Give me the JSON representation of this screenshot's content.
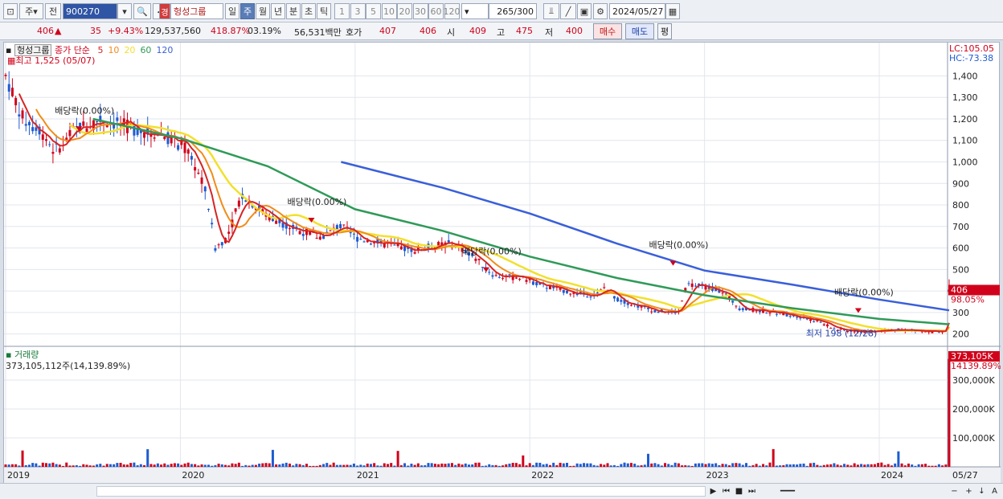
{
  "toolbar": {
    "period_short": "주",
    "prev_label": "전",
    "stock_code": "900270",
    "badge": "경",
    "stock_name": "헝성그룹",
    "periods": [
      "일",
      "주",
      "월",
      "년",
      "분",
      "초",
      "틱"
    ],
    "active_period": "주",
    "numbers": [
      "1",
      "3",
      "5",
      "10",
      "20",
      "30",
      "60",
      "120"
    ],
    "count": "265",
    "count_total": "/300",
    "date": "2024/05/27"
  },
  "quote": {
    "price": "406",
    "arrow": "▲",
    "change": "35",
    "change_pct": "+9.43%",
    "volume": "129,537,560",
    "volume_pct": "418.87%",
    "turnover": "03.19%",
    "amount": "56,531백만",
    "hoga_label": "호가",
    "ask": "407",
    "bid": "406",
    "open_label": "시",
    "open": "409",
    "high_label": "고",
    "high": "475",
    "low_label": "저",
    "low": "400",
    "buy_label": "매수",
    "sell_label": "매도",
    "eval_label": "평"
  },
  "price_panel": {
    "name": "헝성그룹",
    "legend_prefix": "종가 단순",
    "ma": [
      {
        "label": "5",
        "color": "#d62424"
      },
      {
        "label": "10",
        "color": "#f08c1a"
      },
      {
        "label": "20",
        "color": "#f2e02c"
      },
      {
        "label": "60",
        "color": "#2f9a58"
      },
      {
        "label": "120",
        "color": "#3a5fd9"
      }
    ],
    "high_note": "최고 1,525 (05/07)",
    "low_note": "최저 198 (12/28)",
    "lc_label": "LC:105.05",
    "hc_label": "HC:-73.38",
    "price_tag": "406",
    "price_tag_pct": "98.05%",
    "dividend_labels": [
      "배당락(0.00%)",
      "배당락(0.00%)",
      "배당락(0.00%)",
      "배당락(0.00%)",
      "배당락(0.00%)"
    ],
    "y_ticks": [
      "1,400",
      "1,300",
      "1,200",
      "1,100",
      "1,000",
      "900",
      "800",
      "700",
      "600",
      "500",
      "400",
      "300",
      "200"
    ]
  },
  "volume_panel": {
    "title": "거래량",
    "value": "373,105,112주(14,139.89%)",
    "tag": "373,105K",
    "tag_pct": "14139.89%",
    "y_ticks": [
      "300,000K",
      "200,000K",
      "100,000K"
    ]
  },
  "x_axis": [
    "2019",
    "2020",
    "2021",
    "2022",
    "2023",
    "2024"
  ],
  "x_last": "05/27",
  "colors": {
    "up": "#d0021b",
    "down": "#1f5bd1",
    "ma5": "#d62424",
    "ma10": "#f08c1a",
    "ma20": "#f2e02c",
    "ma60": "#2f9a58",
    "ma120": "#3a5fd9"
  },
  "chart_data": {
    "type": "candlestick",
    "ylim": [
      150,
      1525
    ],
    "x_range": [
      "2019",
      "2024-05-27"
    ],
    "ma120": [
      [
        2020.92,
        1000
      ],
      [
        2021.5,
        880
      ],
      [
        2022.0,
        760
      ],
      [
        2022.5,
        620
      ],
      [
        2023.0,
        495
      ],
      [
        2023.5,
        430
      ],
      [
        2024.0,
        360
      ],
      [
        2024.4,
        310
      ]
    ],
    "ma60": [
      [
        2019.5,
        1200
      ],
      [
        2020.0,
        1110
      ],
      [
        2020.5,
        980
      ],
      [
        2021.0,
        780
      ],
      [
        2021.5,
        680
      ],
      [
        2022.0,
        560
      ],
      [
        2022.5,
        460
      ],
      [
        2023.0,
        380
      ],
      [
        2023.5,
        320
      ],
      [
        2024.0,
        270
      ],
      [
        2024.4,
        245
      ]
    ],
    "volume_last": 373105,
    "price_last": 406
  }
}
